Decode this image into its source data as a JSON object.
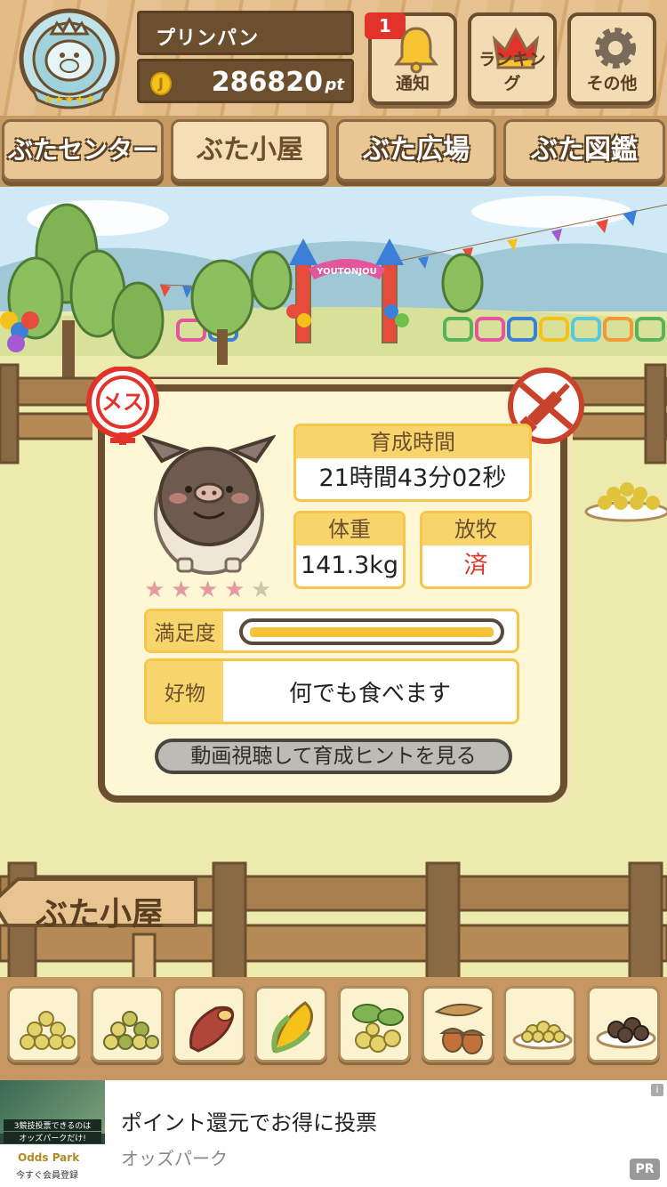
{
  "header": {
    "user_name": "プリンパン",
    "coin_symbol": "J",
    "points": "286820",
    "points_unit": "pt",
    "buttons": {
      "notification": {
        "label": "通知",
        "badge": "1"
      },
      "ranking": {
        "label": "ランキング"
      },
      "other": {
        "label": "その他"
      }
    }
  },
  "tabs": [
    {
      "label": "ぶたセンター",
      "active": false
    },
    {
      "label": "ぶた小屋",
      "active": true
    },
    {
      "label": "ぶた広場",
      "active": false
    },
    {
      "label": "ぶた図鑑",
      "active": false
    }
  ],
  "scene": {
    "gate_sign": "YOUTONJOU",
    "sign_board": "ぶた小屋"
  },
  "pig": {
    "gender_label": "メス",
    "stars": 4,
    "stars_max": 5,
    "raising_time": {
      "label": "育成時間",
      "value": "21時間43分02秒"
    },
    "weight": {
      "label": "体重",
      "value": "141.3kg"
    },
    "grazing": {
      "label": "放牧",
      "value": "済"
    },
    "satisfaction": {
      "label": "満足度",
      "level": 1.0
    },
    "favorite": {
      "label": "好物",
      "value": "何でも食べます"
    },
    "hint_button": "動画視聴して育成ヒントを見る"
  },
  "foods": [
    {
      "icon": "beans-icon"
    },
    {
      "icon": "mixed-beans-icon"
    },
    {
      "icon": "sweet-potato-icon"
    },
    {
      "icon": "corn-icon"
    },
    {
      "icon": "ginkgo-icon"
    },
    {
      "icon": "acorn-icon"
    },
    {
      "icon": "bean-plate-icon"
    },
    {
      "icon": "dark-balls-plate-icon"
    }
  ],
  "ad": {
    "image_text_1": "3競技投票できるのは",
    "image_text_2": "オッズパークだけ!",
    "image_brand": "Odds Park",
    "image_cta": "今すぐ会員登録",
    "title": "ポイント還元でお得に投票",
    "subtitle": "オッズパーク",
    "pr_label": "PR",
    "info_label": "i"
  },
  "colors": {
    "wood": "#d9b07a",
    "accent_yellow": "#f8d56a",
    "female_red": "#e2332a",
    "grazing_red": "#e2332a",
    "dark_brown": "#6b4f2e"
  }
}
